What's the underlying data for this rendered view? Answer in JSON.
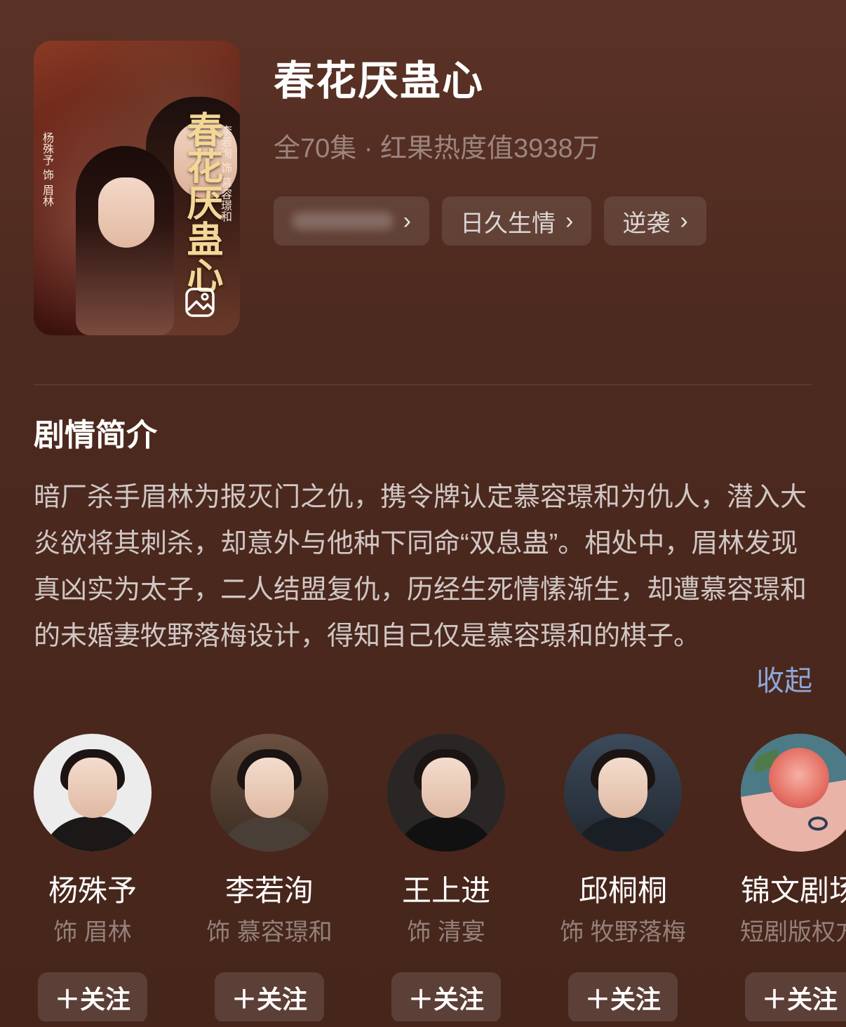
{
  "drama": {
    "title": "春花厌蛊心",
    "meta": "全70集 · 红果热度值3938万",
    "poster": {
      "title": "春花厌蛊心",
      "side_left": "杨殊予 饰 眉林",
      "side_right": "李若洵 饰 慕容璟和"
    },
    "tags": [
      {
        "label": "",
        "blurred": true
      },
      {
        "label": "日久生情"
      },
      {
        "label": "逆袭"
      }
    ],
    "chevron": "›"
  },
  "synopsis": {
    "heading": "剧情简介",
    "text": "暗厂杀手眉林为报灭门之仇，携令牌认定慕容璟和为仇人，潜入大炎欲将其刺杀，却意外与他种下同命“双息蛊”。相处中，眉林发现真凶实为太子，二人结盟复仇，历经生死情愫渐生，却遭慕容璟和的未婚妻牧野落梅设计，得知自己仅是慕容璟和的棋子。",
    "collapse_label": "收起"
  },
  "cast": [
    {
      "name": "杨殊予",
      "role": "饰 眉林",
      "follow": "＋关注"
    },
    {
      "name": "李若洵",
      "role": "饰 慕容璟和",
      "follow": "＋关注"
    },
    {
      "name": "王上进",
      "role": "饰 清宴",
      "follow": "＋关注"
    },
    {
      "name": "邱桐桐",
      "role": "饰 牧野落梅",
      "follow": "＋关注"
    },
    {
      "name": "锦文剧场",
      "role": "短剧版权方",
      "follow": "＋关注"
    }
  ]
}
